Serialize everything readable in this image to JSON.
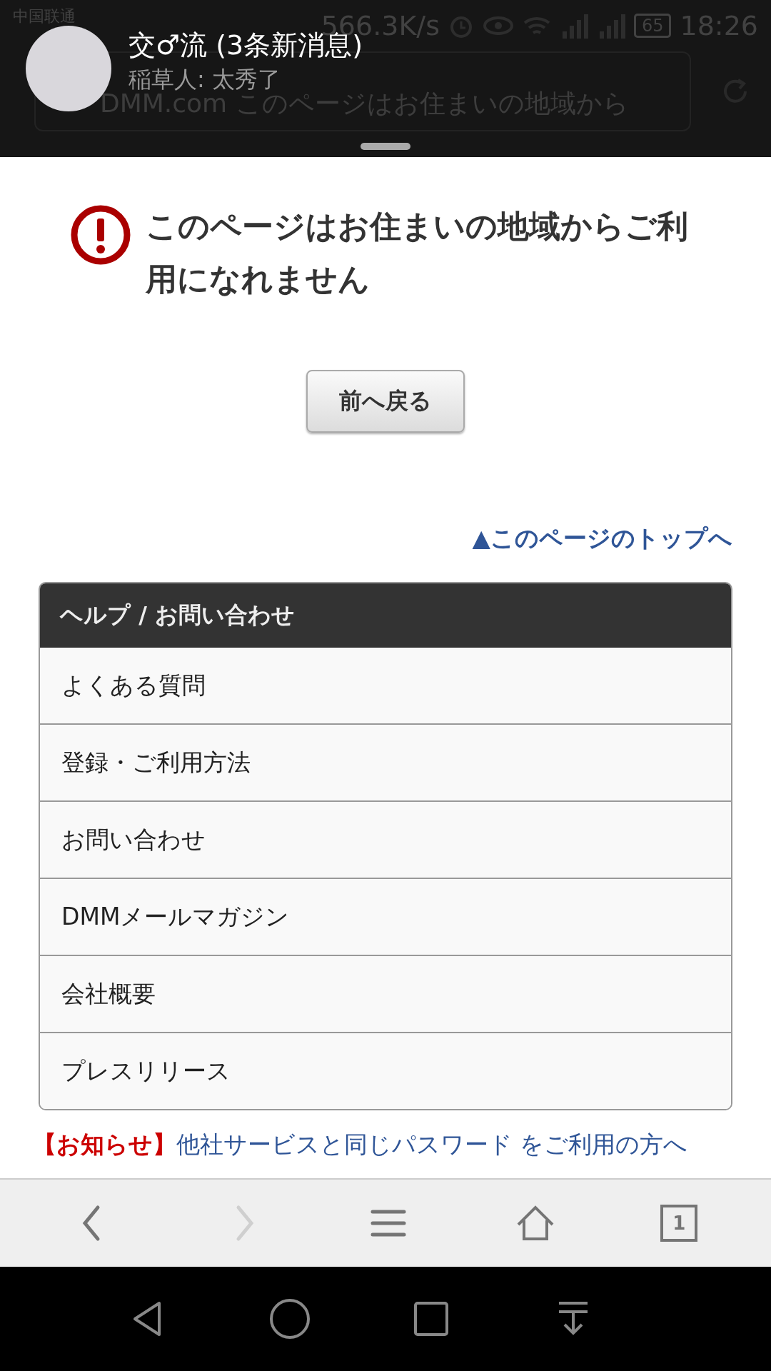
{
  "status_bar": {
    "carrier": "中国联通",
    "speed": "566.3K/s",
    "battery": "65",
    "time": "18:26"
  },
  "address_bar": {
    "url": "DMM.com このページはお住まいの地域から"
  },
  "notification": {
    "title": "交♂流 (3条新消息)",
    "message": "稲草人: 太秀了"
  },
  "error": {
    "message": "このページはお住まいの地域からご利用になれません"
  },
  "back_button": "前へ戻る",
  "page_top_link": "▲このページのトップへ",
  "help_panel": {
    "title": "ヘルプ / お問い合わせ",
    "items": [
      {
        "label": "よくある質問"
      },
      {
        "label": "登録・ご利用方法"
      },
      {
        "label": "お問い合わせ"
      },
      {
        "label": "DMMメールマガジン"
      },
      {
        "label": "会社概要"
      },
      {
        "label": "プレスリリース"
      }
    ]
  },
  "notice": {
    "tag": "【お知らせ】",
    "link": "他社サービスと同じパスワード をご利用の方へ"
  },
  "browser_toolbar": {
    "buttons": [
      {
        "kind": "back",
        "disabled": false
      },
      {
        "kind": "forward",
        "disabled": true
      },
      {
        "kind": "menu",
        "disabled": false
      },
      {
        "kind": "home",
        "disabled": false
      },
      {
        "kind": "tabs",
        "disabled": false,
        "count": "1"
      }
    ]
  },
  "nav_bar": {
    "buttons": [
      {
        "kind": "back"
      },
      {
        "kind": "home"
      },
      {
        "kind": "recents"
      },
      {
        "kind": "down"
      }
    ]
  }
}
